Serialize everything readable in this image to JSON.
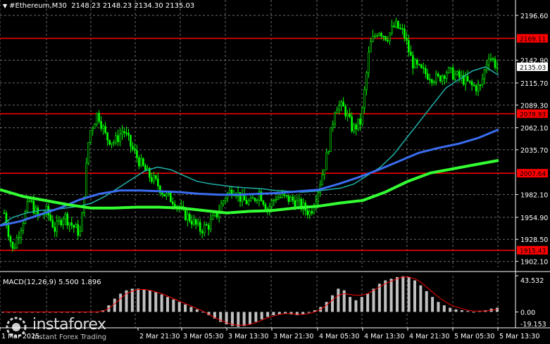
{
  "header": {
    "collapse_icon": "triangle-down-icon",
    "symbol": "#Ethereum,M30",
    "ohlc": "2148.23 2148.23 2134.30 2135.03"
  },
  "price_axis": {
    "ticks": [
      "2196.60",
      "2142.90",
      "2115.70",
      "2089.30",
      "2062.10",
      "2035.70",
      "1982.10",
      "1954.90",
      "1928.50",
      "1902.10"
    ],
    "current_price": "2135.03",
    "current_price_color": "#ffffff"
  },
  "levels": [
    {
      "label": "2169.11",
      "value": 2169.11
    },
    {
      "label": "2078.93",
      "value": 2078.93
    },
    {
      "label": "2007.64",
      "value": 2007.64
    },
    {
      "label": "1915.43",
      "value": 1915.43
    }
  ],
  "level_color": "#ff0000",
  "time_axis": {
    "ticks": [
      "1 Mar 2025",
      "2 Mar 21:30",
      "3 Mar 05:30",
      "3 Mar 13:30",
      "3 Mar 21:30",
      "4 Mar 05:30",
      "4 Mar 13:30",
      "4 Mar 21:30",
      "5 Mar 05:30",
      "5 Mar 13:30"
    ]
  },
  "macd": {
    "label": "MACD(12,26,9) 5.500 1.896",
    "ticks": [
      "43.532",
      "0.00",
      "-19.153"
    ],
    "histogram_color": "#c0c0c0",
    "signal_color": "#ff0000"
  },
  "colors": {
    "background": "#000000",
    "grid": "#6b6b6b",
    "candle": "#00ff00",
    "ma_fast": "#20b2aa",
    "ma_mid": "#3a6df0",
    "ma_slow": "#33ff33"
  },
  "brand": {
    "name": "instaforex",
    "tagline": "Instant Forex Trading"
  },
  "chart_data": {
    "type": "candlestick",
    "symbol": "#Ethereum",
    "timeframe": "M30",
    "ylim": [
      1895,
      2215
    ],
    "x_ticks": [
      "1 Mar 2025",
      "2 Mar 21:30",
      "3 Mar 05:30",
      "3 Mar 13:30",
      "3 Mar 21:30",
      "4 Mar 05:30",
      "4 Mar 13:30",
      "4 Mar 21:30",
      "5 Mar 05:30",
      "5 Mar 13:30"
    ],
    "price_path": [
      1960,
      1915,
      1945,
      1975,
      1955,
      1962,
      1940,
      1958,
      1945,
      1935,
      2055,
      2080,
      2050,
      2045,
      2060,
      2038,
      2020,
      2005,
      1995,
      1980,
      1975,
      1960,
      1952,
      1940,
      1945,
      1958,
      1980,
      1990,
      1975,
      1972,
      1985,
      1965,
      1980,
      1978,
      1975,
      1968,
      1960,
      1990,
      2030,
      2090,
      2085,
      2060,
      2070,
      2160,
      2180,
      2170,
      2185,
      2175,
      2140,
      2130,
      2125,
      2120,
      2130,
      2125,
      2120,
      2112,
      2110,
      2150,
      2135
    ],
    "ma_fast": [
      1945,
      1955,
      1960,
      1963,
      1964,
      1966,
      1968,
      1972,
      1980,
      1990,
      2000,
      2010,
      2015,
      2012,
      2005,
      1998,
      1995,
      1993,
      1991,
      1990,
      1989,
      1987,
      1986,
      1985,
      1986,
      1988,
      1990,
      1995,
      2005,
      2015,
      2030,
      2050,
      2070,
      2090,
      2110,
      2120,
      2130,
      2135,
      2125
    ],
    "ma_mid": [
      1945,
      1950,
      1958,
      1966,
      1976,
      1983,
      1987,
      1987,
      1986,
      1985,
      1983,
      1982,
      1982,
      1983,
      1984,
      1986,
      1988,
      1995,
      2003,
      2012,
      2022,
      2032,
      2038,
      2043,
      2050,
      2060
    ],
    "ma_slow": [
      1988,
      1980,
      1975,
      1970,
      1966,
      1966,
      1967,
      1967,
      1966,
      1963,
      1960,
      1962,
      1963,
      1966,
      1968,
      1972,
      1975,
      1985,
      1998,
      2008,
      2013,
      2018,
      2023
    ],
    "macd_histogram": [
      0,
      0,
      0,
      0,
      0,
      0,
      0,
      0,
      0,
      0,
      0,
      0,
      0,
      0,
      0,
      0,
      0,
      2,
      8,
      16,
      22,
      26,
      28,
      28,
      27,
      26,
      24,
      21,
      18,
      15,
      12,
      9,
      6,
      3,
      0,
      -4,
      -8,
      -12,
      -15,
      -17,
      -18,
      -17,
      -15,
      -12,
      -9,
      -6,
      -4,
      -3,
      -2,
      -3,
      -4,
      -3,
      -1,
      2,
      6,
      12,
      20,
      28,
      26,
      18,
      14,
      18,
      22,
      28,
      34,
      38,
      40,
      42,
      43,
      42,
      38,
      32,
      25,
      18,
      12,
      8,
      5,
      3,
      2,
      1,
      0,
      1,
      2,
      4,
      5
    ],
    "macd_signal": [
      0,
      0,
      0,
      0,
      0,
      0,
      0,
      0,
      0,
      0,
      0,
      0,
      0,
      0,
      0,
      0,
      0,
      1,
      4,
      10,
      16,
      22,
      25,
      27,
      27,
      26,
      24,
      22,
      19,
      16,
      13,
      10,
      7,
      4,
      1,
      -3,
      -7,
      -10,
      -13,
      -15,
      -16,
      -16,
      -15,
      -13,
      -10,
      -7,
      -5,
      -3,
      -2,
      -2,
      -3,
      -3,
      -2,
      0,
      3,
      8,
      14,
      20,
      22,
      21,
      20,
      20,
      22,
      26,
      30,
      34,
      37,
      40,
      42,
      42,
      40,
      36,
      30,
      24,
      18,
      13,
      9,
      6,
      4,
      2,
      1,
      1,
      1,
      2,
      3
    ],
    "macd_ylim": [
      -19.153,
      43.532
    ]
  }
}
